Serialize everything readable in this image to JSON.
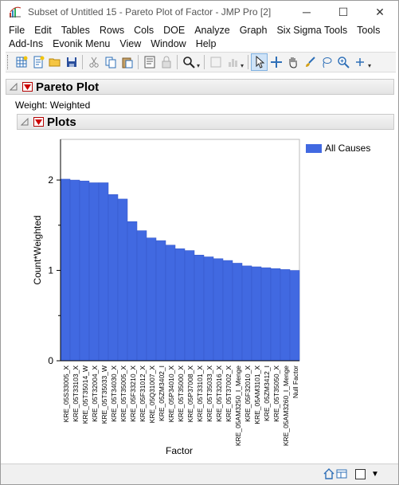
{
  "window": {
    "title": "Subset of Untitled 15 - Pareto Plot of Factor - JMP Pro [2]",
    "minimize_glyph": "─",
    "maximize_glyph": "☐",
    "close_glyph": "✕"
  },
  "menu": {
    "row1": [
      "File",
      "Edit",
      "Tables",
      "Rows",
      "Cols",
      "DOE",
      "Analyze",
      "Graph",
      "Six Sigma Tools",
      "Tools"
    ],
    "row2": [
      "Add-Ins",
      "Evonik Menu",
      "View",
      "Window",
      "Help"
    ]
  },
  "toolbar": {
    "icons": [
      "new-data-table-icon",
      "new-script-icon",
      "open-icon",
      "save-icon",
      "cut-icon",
      "copy-icon",
      "paste-icon",
      "journal-icon",
      "lock-icon",
      "search-icon",
      "arrow-tool-icon",
      "crosshair-tool-icon",
      "hand-tool-icon",
      "brush-tool-icon",
      "lasso-tool-icon",
      "magnifier-tool-icon",
      "annotate-tool-icon"
    ]
  },
  "report": {
    "pareto_title": "Pareto Plot",
    "weight_label": "Weight: Weighted",
    "plots_title": "Plots"
  },
  "legend": {
    "label": "All Causes"
  },
  "colors": {
    "bar": "#4169e1",
    "bar_edge": "#3457c8",
    "red_triangle": "#cc0000",
    "header_bg": "#e6e6e6"
  },
  "chart_data": {
    "type": "bar",
    "title": "",
    "xlabel": "Factor",
    "ylabel": "Count*Weighted",
    "ylim": [
      0,
      2.45
    ],
    "yticks": [
      0,
      1,
      2
    ],
    "grid": false,
    "legend_position": "right",
    "series": [
      {
        "name": "All Causes"
      }
    ],
    "categories": [
      "KRE_05S33005_X",
      "KRE_05T33103_X",
      "KRE_05T35014_W",
      "KRE_05T32004_X",
      "KRE_05T35033_W",
      "KRE_05T34030_X",
      "KRE_05T35005_X",
      "KRE_05F33210_X",
      "KRE_05F31012_X",
      "KRE_05Q31007_X",
      "KRE_05ZM3402_I",
      "KRE_05P34010_X",
      "KRE_05T35000_X",
      "KRE_05P37008_X",
      "KRE_05T33101_X",
      "KRE_05T35033_X",
      "KRE_05T32016_X",
      "KRE_05T37002_X",
      "KRE_05AM3250_I_Menge",
      "KRE_05F32010_X",
      "KRE_05AM3101_X",
      "KRE_05ZM3412_I",
      "KRE_05T35050_X",
      "KRE_05AM3260_I_Menge",
      "Null Factor"
    ],
    "values": [
      2.01,
      2.0,
      1.99,
      1.97,
      1.97,
      1.84,
      1.79,
      1.54,
      1.44,
      1.36,
      1.33,
      1.28,
      1.24,
      1.22,
      1.17,
      1.15,
      1.13,
      1.11,
      1.08,
      1.05,
      1.04,
      1.03,
      1.02,
      1.01,
      1.0
    ]
  },
  "statusbar": {
    "home_icon": "home-icon",
    "layout_icon": "layout-icon",
    "dropdown_glyph": "▼"
  }
}
